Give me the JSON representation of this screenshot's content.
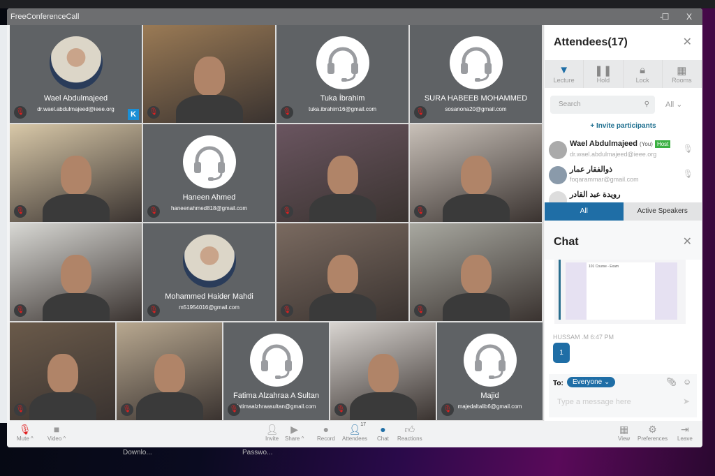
{
  "window": {
    "title": "FreeConferenceCall",
    "minimize": "-",
    "maximize": "☐",
    "close": "X"
  },
  "tiles": [
    {
      "type": "avatar",
      "name": "Wael Abdulmajeed",
      "email": "dr.wael.abdulmajeed@ieee.org",
      "badge": "K"
    },
    {
      "type": "video",
      "color": "#9a7a55"
    },
    {
      "type": "headset",
      "name": "Tuka İbrahim",
      "email": "tuka.ibrahim16@gmail.com"
    },
    {
      "type": "headset",
      "name": "SURA HABEEB MOHAMMED",
      "email": "sosanona20@gmail.com"
    },
    {
      "type": "video",
      "color": "#d8c8a8"
    },
    {
      "type": "headset",
      "name": "Haneen Ahmed",
      "email": "haneenahmed818@gmail.com"
    },
    {
      "type": "video",
      "color": "#6a5560"
    },
    {
      "type": "video",
      "color": "#c8c0b8"
    },
    {
      "type": "video",
      "color": "#d8d8d4"
    },
    {
      "type": "avatar",
      "name": "Mohammed Haider Mahdi",
      "email": "m51954016@gmail.com"
    },
    {
      "type": "video",
      "color": "#7a6a60"
    },
    {
      "type": "video",
      "color": "#a8a8a0"
    },
    {
      "type": "video",
      "color": "#6a5a4a"
    },
    {
      "type": "video",
      "color": "#b8a890"
    },
    {
      "type": "headset",
      "name": "Fatima Alzahraa A Sultan",
      "email": "fatimaalzhraasultan@gmail.com"
    },
    {
      "type": "video",
      "color": "#d8d4d0"
    },
    {
      "type": "headset",
      "name": "Majid",
      "email": "majedaltalib6@gmail.com"
    }
  ],
  "attendees": {
    "title": "Attendees(17)",
    "tools": [
      {
        "label": "Lecture",
        "icon": "podium-icon"
      },
      {
        "label": "Hold",
        "icon": "pause-icon"
      },
      {
        "label": "Lock",
        "icon": "lock-icon"
      },
      {
        "label": "Rooms",
        "icon": "grid-icon"
      }
    ],
    "search_placeholder": "Search",
    "filter": "All",
    "invite": "+ Invite participants",
    "list": [
      {
        "name": "Wael Abdulmajeed",
        "you": "(You)",
        "role": "Host",
        "email": "dr.wael.abdulmajeed@ieee.org"
      },
      {
        "name": "ذوالفقار عمار",
        "email": "foqarammar@gmail.com"
      },
      {
        "name": "رويدة عبد القادر"
      }
    ],
    "tabs": [
      "All",
      "Active Speakers"
    ]
  },
  "chat": {
    "title": "Chat",
    "image_caption": "101 Course - Exam",
    "sender": "HUSSAM .M  6:47 PM",
    "message": "1",
    "to_label": "To:",
    "recipient": "Everyone ⌄",
    "placeholder": "Type a message here"
  },
  "toolbar": {
    "left": [
      {
        "label": "Mute ^",
        "icon": "mic-muted-icon"
      },
      {
        "label": "Video ^",
        "icon": "video-icon"
      }
    ],
    "center": [
      {
        "label": "Invite",
        "icon": "add-user-icon"
      },
      {
        "label": "Share ^",
        "icon": "share-icon"
      },
      {
        "label": "Record",
        "icon": "record-icon"
      },
      {
        "label": "Attendees",
        "icon": "attendees-icon",
        "count": "17"
      },
      {
        "label": "Chat",
        "icon": "chat-icon"
      },
      {
        "label": "Reactions",
        "icon": "thumbs-up-icon"
      }
    ],
    "right": [
      {
        "label": "View",
        "icon": "view-icon"
      },
      {
        "label": "Preferences",
        "icon": "gear-icon"
      },
      {
        "label": "Leave",
        "icon": "leave-icon"
      }
    ]
  },
  "desktop": {
    "item1": "Downlo...",
    "item2": "Passwo..."
  },
  "colors": {
    "accent": "#1f6ea6",
    "muted_mic": "#e02020",
    "host": "#3cb043"
  }
}
